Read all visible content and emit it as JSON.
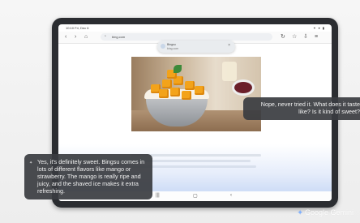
{
  "statusbar": {
    "time": "10:10 Fri, Dec 6",
    "icons": "✦ ▾ ▮"
  },
  "browser": {
    "back_icon": "back-arrow-icon",
    "forward_icon": "forward-arrow-icon",
    "home_icon": "home-icon",
    "url": "bing.com",
    "refresh_icon": "refresh-icon",
    "popup": {
      "title": "Bingsu",
      "subtitle": "bing.com"
    }
  },
  "chat": {
    "user_message": "Nope, never tried it. What does it taste like? Is it kind of sweet?",
    "ai_message": "Yes, it's definitely sweet. Bingsu comes in lots of different flavors like mango or strawberry. The mango is really ripe and juicy, and the shaved ice makes it extra refreshing."
  },
  "branding": {
    "name": "Google Gemini"
  },
  "colors": {
    "bubble_bg": "#3a3c40",
    "accent": "#7fb0ff"
  }
}
